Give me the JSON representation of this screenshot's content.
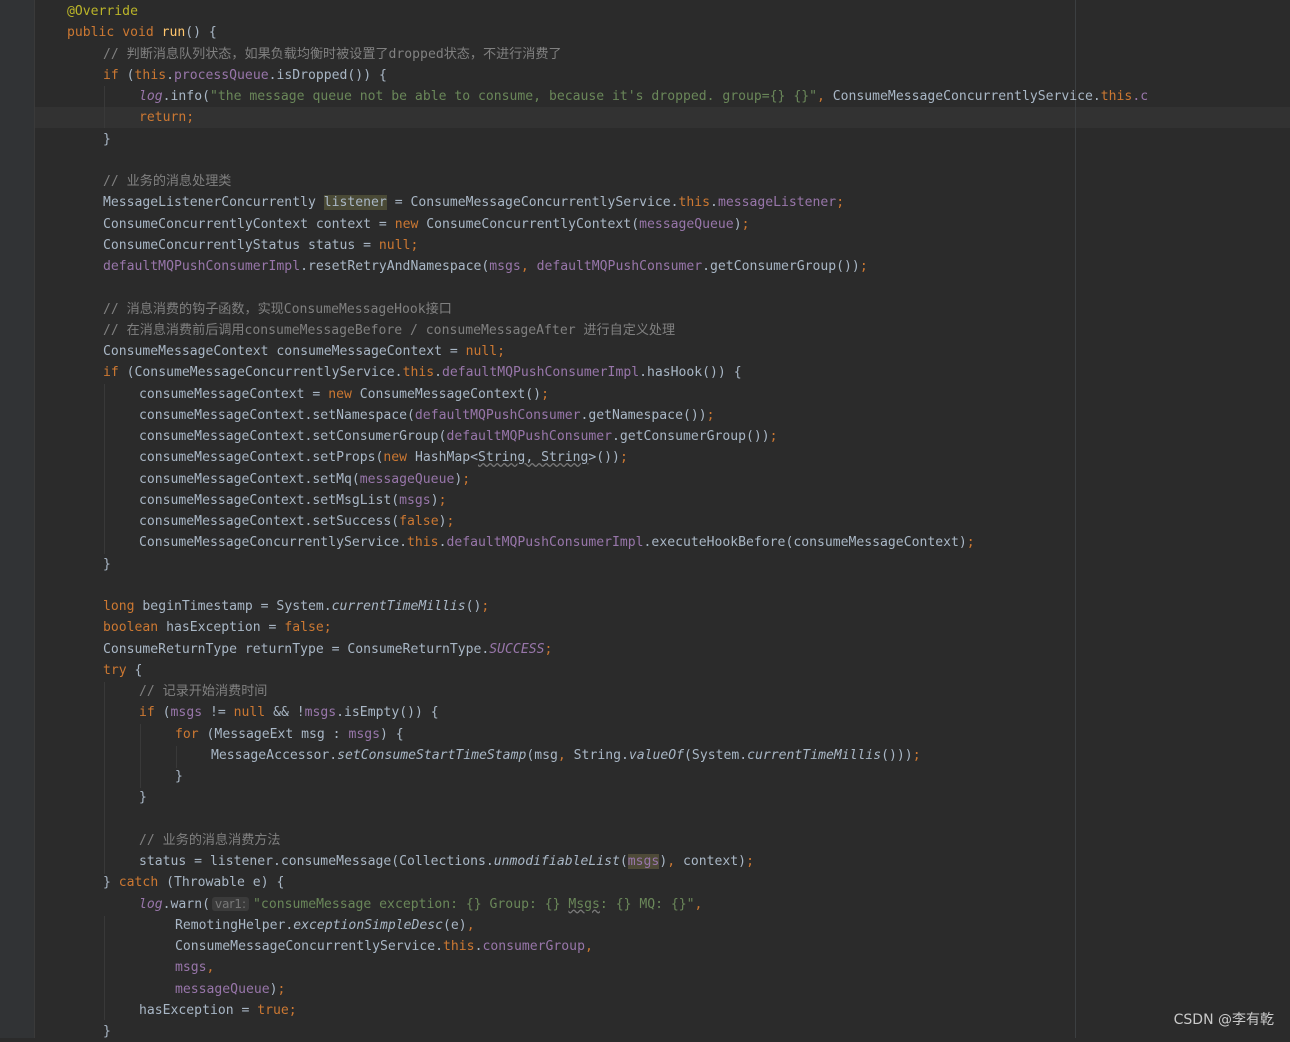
{
  "editor": {
    "theme": {
      "background": "#2b2b2b",
      "keyword": "#cc7832",
      "annotation": "#bbb529",
      "field": "#9876aa",
      "method_decl": "#ffc66d",
      "string": "#6a8759",
      "comment": "#808080",
      "default": "#a9b7c6"
    },
    "lines": [
      {
        "indent": 1,
        "tokens": [
          {
            "t": "@Override",
            "c": "an"
          }
        ]
      },
      {
        "indent": 1,
        "tokens": [
          {
            "t": "public ",
            "c": "kw"
          },
          {
            "t": "void ",
            "c": "kw"
          },
          {
            "t": "run",
            "c": "fn"
          },
          {
            "t": "() {"
          }
        ]
      },
      {
        "indent": 2,
        "tokens": [
          {
            "t": "// 判断消息队列状态，如果负载均衡时被设置了dropped状态，不进行消费了",
            "c": "cm"
          }
        ]
      },
      {
        "indent": 2,
        "tokens": [
          {
            "t": "if ",
            "c": "kw"
          },
          {
            "t": "("
          },
          {
            "t": "this",
            "c": "kw"
          },
          {
            "t": "."
          },
          {
            "t": "processQueue",
            "c": "fd"
          },
          {
            "t": ".isDropped()) {"
          }
        ]
      },
      {
        "indent": 3,
        "tokens": [
          {
            "t": "log",
            "c": "fi"
          },
          {
            "t": ".info("
          },
          {
            "t": "\"the message queue not be able to consume, because it's dropped. group={} {}\"",
            "c": "st"
          },
          {
            "t": ", ",
            "c": "kw"
          },
          {
            "t": "ConsumeMessageConcurrentlyService."
          },
          {
            "t": "this",
            "c": "kw"
          },
          {
            "t": ".c",
            "c": "fd"
          }
        ]
      },
      {
        "indent": 3,
        "tokens": [
          {
            "t": "return;",
            "c": "kw"
          }
        ]
      },
      {
        "indent": 2,
        "tokens": [
          {
            "t": "}"
          }
        ]
      },
      {
        "indent": 0,
        "tokens": []
      },
      {
        "indent": 2,
        "tokens": [
          {
            "t": "// 业务的消息处理类",
            "c": "cm"
          }
        ]
      },
      {
        "indent": 2,
        "tokens": [
          {
            "t": "MessageListenerConcurrently "
          },
          {
            "t": "listener",
            "c": "hl"
          },
          {
            "t": " = ConsumeMessageConcurrentlyService."
          },
          {
            "t": "this",
            "c": "kw"
          },
          {
            "t": "."
          },
          {
            "t": "messageListener",
            "c": "fd"
          },
          {
            "t": ";",
            "c": "kw"
          }
        ]
      },
      {
        "indent": 2,
        "tokens": [
          {
            "t": "ConsumeConcurrentlyContext context = "
          },
          {
            "t": "new ",
            "c": "kw"
          },
          {
            "t": "ConsumeConcurrentlyContext("
          },
          {
            "t": "messageQueue",
            "c": "fd"
          },
          {
            "t": ")"
          },
          {
            "t": ";",
            "c": "kw"
          }
        ]
      },
      {
        "indent": 2,
        "tokens": [
          {
            "t": "ConsumeConcurrentlyStatus status = "
          },
          {
            "t": "null;",
            "c": "kw"
          }
        ]
      },
      {
        "indent": 2,
        "tokens": [
          {
            "t": "defaultMQPushConsumerImpl",
            "c": "fd"
          },
          {
            "t": ".resetRetryAndNamespace("
          },
          {
            "t": "msgs",
            "c": "fd"
          },
          {
            "t": ", ",
            "c": "kw"
          },
          {
            "t": "defaultMQPushConsumer",
            "c": "fd"
          },
          {
            "t": ".getConsumerGroup())"
          },
          {
            "t": ";",
            "c": "kw"
          }
        ]
      },
      {
        "indent": 0,
        "tokens": []
      },
      {
        "indent": 2,
        "tokens": [
          {
            "t": "// 消息消费的钩子函数，实现ConsumeMessageHook接口",
            "c": "cm"
          }
        ]
      },
      {
        "indent": 2,
        "tokens": [
          {
            "t": "// 在消息消费前后调用consumeMessageBefore / consumeMessageAfter 进行自定义处理",
            "c": "cm"
          }
        ]
      },
      {
        "indent": 2,
        "tokens": [
          {
            "t": "ConsumeMessageContext consumeMessageContext = "
          },
          {
            "t": "null;",
            "c": "kw"
          }
        ]
      },
      {
        "indent": 2,
        "tokens": [
          {
            "t": "if ",
            "c": "kw"
          },
          {
            "t": "(ConsumeMessageConcurrentlyService."
          },
          {
            "t": "this",
            "c": "kw"
          },
          {
            "t": "."
          },
          {
            "t": "defaultMQPushConsumerImpl",
            "c": "fd"
          },
          {
            "t": ".hasHook()) {"
          }
        ]
      },
      {
        "indent": 3,
        "tokens": [
          {
            "t": "consumeMessageContext = "
          },
          {
            "t": "new ",
            "c": "kw"
          },
          {
            "t": "ConsumeMessageContext()"
          },
          {
            "t": ";",
            "c": "kw"
          }
        ]
      },
      {
        "indent": 3,
        "tokens": [
          {
            "t": "consumeMessageContext.setNamespace("
          },
          {
            "t": "defaultMQPushConsumer",
            "c": "fd"
          },
          {
            "t": ".getNamespace())"
          },
          {
            "t": ";",
            "c": "kw"
          }
        ]
      },
      {
        "indent": 3,
        "tokens": [
          {
            "t": "consumeMessageContext.setConsumerGroup("
          },
          {
            "t": "defaultMQPushConsumer",
            "c": "fd"
          },
          {
            "t": ".getConsumerGroup())"
          },
          {
            "t": ";",
            "c": "kw"
          }
        ]
      },
      {
        "indent": 3,
        "tokens": [
          {
            "t": "consumeMessageContext.setProps("
          },
          {
            "t": "new ",
            "c": "kw"
          },
          {
            "t": "HashMap<"
          },
          {
            "t": "String, String",
            "c": "uw"
          },
          {
            "t": ">())"
          },
          {
            "t": ";",
            "c": "kw"
          }
        ]
      },
      {
        "indent": 3,
        "tokens": [
          {
            "t": "consumeMessageContext.setMq("
          },
          {
            "t": "messageQueue",
            "c": "fd"
          },
          {
            "t": ")"
          },
          {
            "t": ";",
            "c": "kw"
          }
        ]
      },
      {
        "indent": 3,
        "tokens": [
          {
            "t": "consumeMessageContext.setMsgList("
          },
          {
            "t": "msgs",
            "c": "fd"
          },
          {
            "t": ")"
          },
          {
            "t": ";",
            "c": "kw"
          }
        ]
      },
      {
        "indent": 3,
        "tokens": [
          {
            "t": "consumeMessageContext.setSuccess("
          },
          {
            "t": "false",
            "c": "kw"
          },
          {
            "t": ")"
          },
          {
            "t": ";",
            "c": "kw"
          }
        ]
      },
      {
        "indent": 3,
        "tokens": [
          {
            "t": "ConsumeMessageConcurrentlyService."
          },
          {
            "t": "this",
            "c": "kw"
          },
          {
            "t": "."
          },
          {
            "t": "defaultMQPushConsumerImpl",
            "c": "fd"
          },
          {
            "t": ".executeHookBefore(consumeMessageContext)"
          },
          {
            "t": ";",
            "c": "kw"
          }
        ]
      },
      {
        "indent": 2,
        "tokens": [
          {
            "t": "}"
          }
        ]
      },
      {
        "indent": 0,
        "tokens": []
      },
      {
        "indent": 2,
        "tokens": [
          {
            "t": "long ",
            "c": "kw"
          },
          {
            "t": "beginTimestamp = System."
          },
          {
            "t": "currentTimeMillis",
            "c": "it"
          },
          {
            "t": "()"
          },
          {
            "t": ";",
            "c": "kw"
          }
        ]
      },
      {
        "indent": 2,
        "tokens": [
          {
            "t": "boolean ",
            "c": "kw"
          },
          {
            "t": "hasException = "
          },
          {
            "t": "false;",
            "c": "kw"
          }
        ]
      },
      {
        "indent": 2,
        "tokens": [
          {
            "t": "ConsumeReturnType returnType = ConsumeReturnType."
          },
          {
            "t": "SUCCESS",
            "c": "sx"
          },
          {
            "t": ";",
            "c": "kw"
          }
        ]
      },
      {
        "indent": 2,
        "tokens": [
          {
            "t": "try ",
            "c": "kw"
          },
          {
            "t": "{"
          }
        ]
      },
      {
        "indent": 3,
        "tokens": [
          {
            "t": "// 记录开始消费时间",
            "c": "cm"
          }
        ]
      },
      {
        "indent": 3,
        "tokens": [
          {
            "t": "if ",
            "c": "kw"
          },
          {
            "t": "("
          },
          {
            "t": "msgs",
            "c": "fd"
          },
          {
            "t": " != "
          },
          {
            "t": "null ",
            "c": "kw"
          },
          {
            "t": "&& !"
          },
          {
            "t": "msgs",
            "c": "fd"
          },
          {
            "t": ".isEmpty()) {"
          }
        ]
      },
      {
        "indent": 4,
        "tokens": [
          {
            "t": "for ",
            "c": "kw"
          },
          {
            "t": "(MessageExt msg : "
          },
          {
            "t": "msgs",
            "c": "fd"
          },
          {
            "t": ") {"
          }
        ]
      },
      {
        "indent": 5,
        "tokens": [
          {
            "t": "MessageAccessor."
          },
          {
            "t": "setConsumeStartTimeStamp",
            "c": "it"
          },
          {
            "t": "(msg"
          },
          {
            "t": ", ",
            "c": "kw"
          },
          {
            "t": "String."
          },
          {
            "t": "valueOf",
            "c": "it"
          },
          {
            "t": "(System."
          },
          {
            "t": "currentTimeMillis",
            "c": "it"
          },
          {
            "t": "()))"
          },
          {
            "t": ";",
            "c": "kw"
          }
        ]
      },
      {
        "indent": 4,
        "tokens": [
          {
            "t": "}"
          }
        ]
      },
      {
        "indent": 3,
        "tokens": [
          {
            "t": "}"
          }
        ]
      },
      {
        "indent": 0,
        "tokens": []
      },
      {
        "indent": 3,
        "tokens": [
          {
            "t": "// 业务的消息消费方法",
            "c": "cm"
          }
        ]
      },
      {
        "indent": 3,
        "tokens": [
          {
            "t": "status = listener.consumeMessage(Collections."
          },
          {
            "t": "unmodifiableList",
            "c": "it"
          },
          {
            "t": "("
          },
          {
            "t": "msgs",
            "c": "fd hl2"
          },
          {
            "t": ")"
          },
          {
            "t": ", ",
            "c": "kw"
          },
          {
            "t": "context)"
          },
          {
            "t": ";",
            "c": "kw"
          }
        ]
      },
      {
        "indent": 2,
        "tokens": [
          {
            "t": "} "
          },
          {
            "t": "catch ",
            "c": "kw"
          },
          {
            "t": "(Throwable e) {"
          }
        ]
      },
      {
        "indent": 3,
        "tokens": [
          {
            "t": "log",
            "c": "fi"
          },
          {
            "t": ".warn("
          },
          {
            "t": "var1:",
            "c": "hint"
          },
          {
            "t": "\"consumeMessage exception: {} Group: {} ",
            "c": "st"
          },
          {
            "t": "Msgs",
            "c": "st uw"
          },
          {
            "t": ": {} MQ: {}\"",
            "c": "st"
          },
          {
            "t": ",",
            "c": "kw"
          }
        ]
      },
      {
        "indent": 4,
        "tokens": [
          {
            "t": "RemotingHelper."
          },
          {
            "t": "exceptionSimpleDesc",
            "c": "it"
          },
          {
            "t": "(e)"
          },
          {
            "t": ",",
            "c": "kw"
          }
        ]
      },
      {
        "indent": 4,
        "tokens": [
          {
            "t": "ConsumeMessageConcurrentlyService."
          },
          {
            "t": "this",
            "c": "kw"
          },
          {
            "t": "."
          },
          {
            "t": "consumerGroup",
            "c": "fd"
          },
          {
            "t": ",",
            "c": "kw"
          }
        ]
      },
      {
        "indent": 4,
        "tokens": [
          {
            "t": "msgs",
            "c": "fd"
          },
          {
            "t": ",",
            "c": "kw"
          }
        ]
      },
      {
        "indent": 4,
        "tokens": [
          {
            "t": "messageQueue",
            "c": "fd"
          },
          {
            "t": ")"
          },
          {
            "t": ";",
            "c": "kw"
          }
        ]
      },
      {
        "indent": 3,
        "tokens": [
          {
            "t": "hasException = "
          },
          {
            "t": "true;",
            "c": "kw"
          }
        ]
      },
      {
        "indent": 2,
        "tokens": [
          {
            "t": "}"
          }
        ]
      }
    ]
  },
  "watermark": "CSDN @李有乾"
}
